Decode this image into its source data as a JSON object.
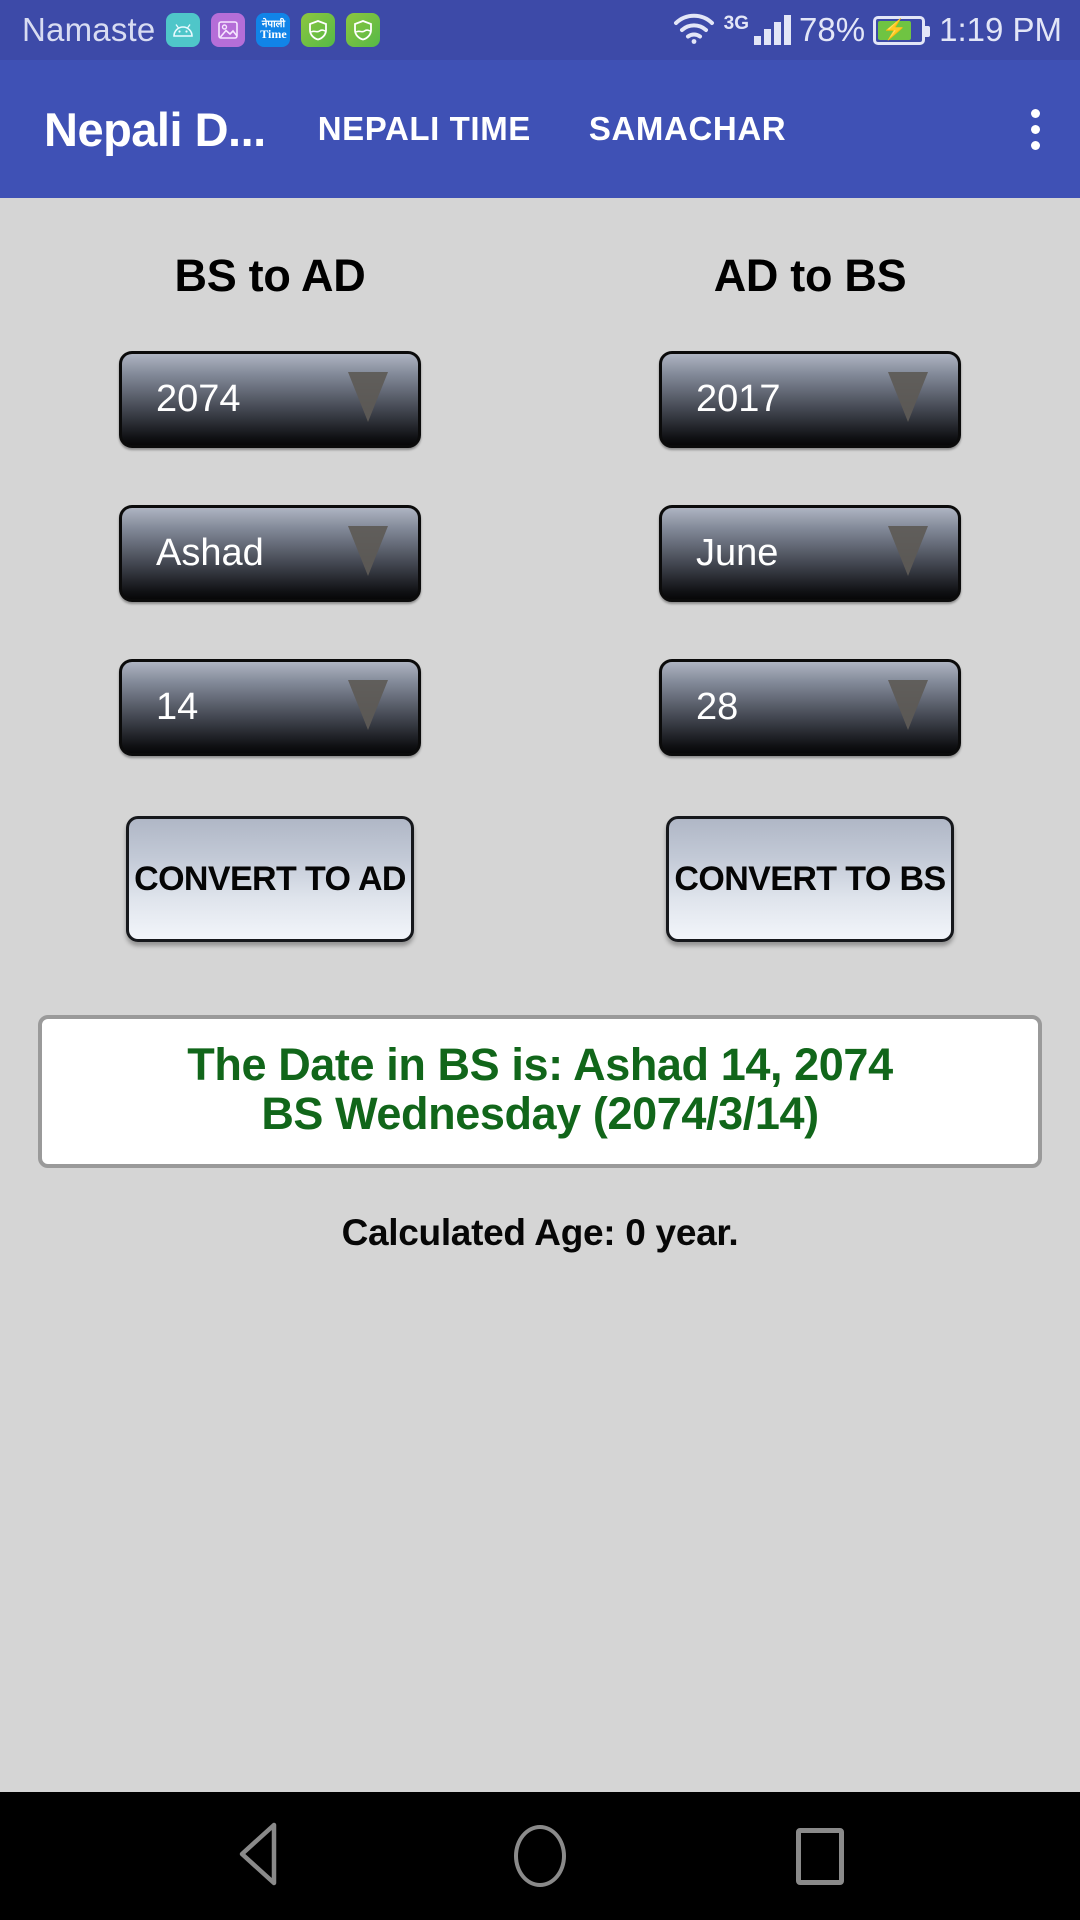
{
  "status_bar": {
    "carrier": "Namaste",
    "notification_icons": [
      {
        "name": "android-icon",
        "glyph": "android"
      },
      {
        "name": "screenshot-image-icon",
        "glyph": "image"
      },
      {
        "name": "nepali-time-icon",
        "top": "नेपाली",
        "bottom": "Time"
      },
      {
        "name": "security-shield-icon-1",
        "glyph": "shield"
      },
      {
        "name": "security-shield-icon-2",
        "glyph": "shield"
      }
    ],
    "network_type": "3G",
    "battery_percent": "78%",
    "battery_level": 78,
    "battery_charging": true,
    "time": "1:19 PM",
    "background_color": "#3d4aa8"
  },
  "app_bar": {
    "title": "Nepali D...",
    "tabs": [
      {
        "label": "NEPALI TIME"
      },
      {
        "label": "SAMACHAR"
      }
    ],
    "overflow_label": "more-options",
    "background_color": "#3f51b5"
  },
  "converters": [
    {
      "heading": "BS to AD",
      "spinners": [
        {
          "name": "bs-year-spinner",
          "value": "2074"
        },
        {
          "name": "bs-month-spinner",
          "value": "Ashad"
        },
        {
          "name": "bs-day-spinner",
          "value": "14"
        }
      ],
      "button": {
        "name": "convert-to-ad-button",
        "label": "CONVERT TO AD"
      }
    },
    {
      "heading": "AD to BS",
      "spinners": [
        {
          "name": "ad-year-spinner",
          "value": "2017"
        },
        {
          "name": "ad-month-spinner",
          "value": "June"
        },
        {
          "name": "ad-day-spinner",
          "value": "28"
        }
      ],
      "button": {
        "name": "convert-to-bs-button",
        "label": "CONVERT TO BS"
      }
    }
  ],
  "result": {
    "line1": "The Date in BS is: Ashad 14, 2074",
    "line2": "BS Wednesday (2074/3/14)",
    "text_color": "#11661a"
  },
  "age": {
    "text": "Calculated Age: 0 year."
  },
  "nav_bar": {
    "back_label": "Back",
    "home_label": "Home",
    "recents_label": "Recents"
  }
}
